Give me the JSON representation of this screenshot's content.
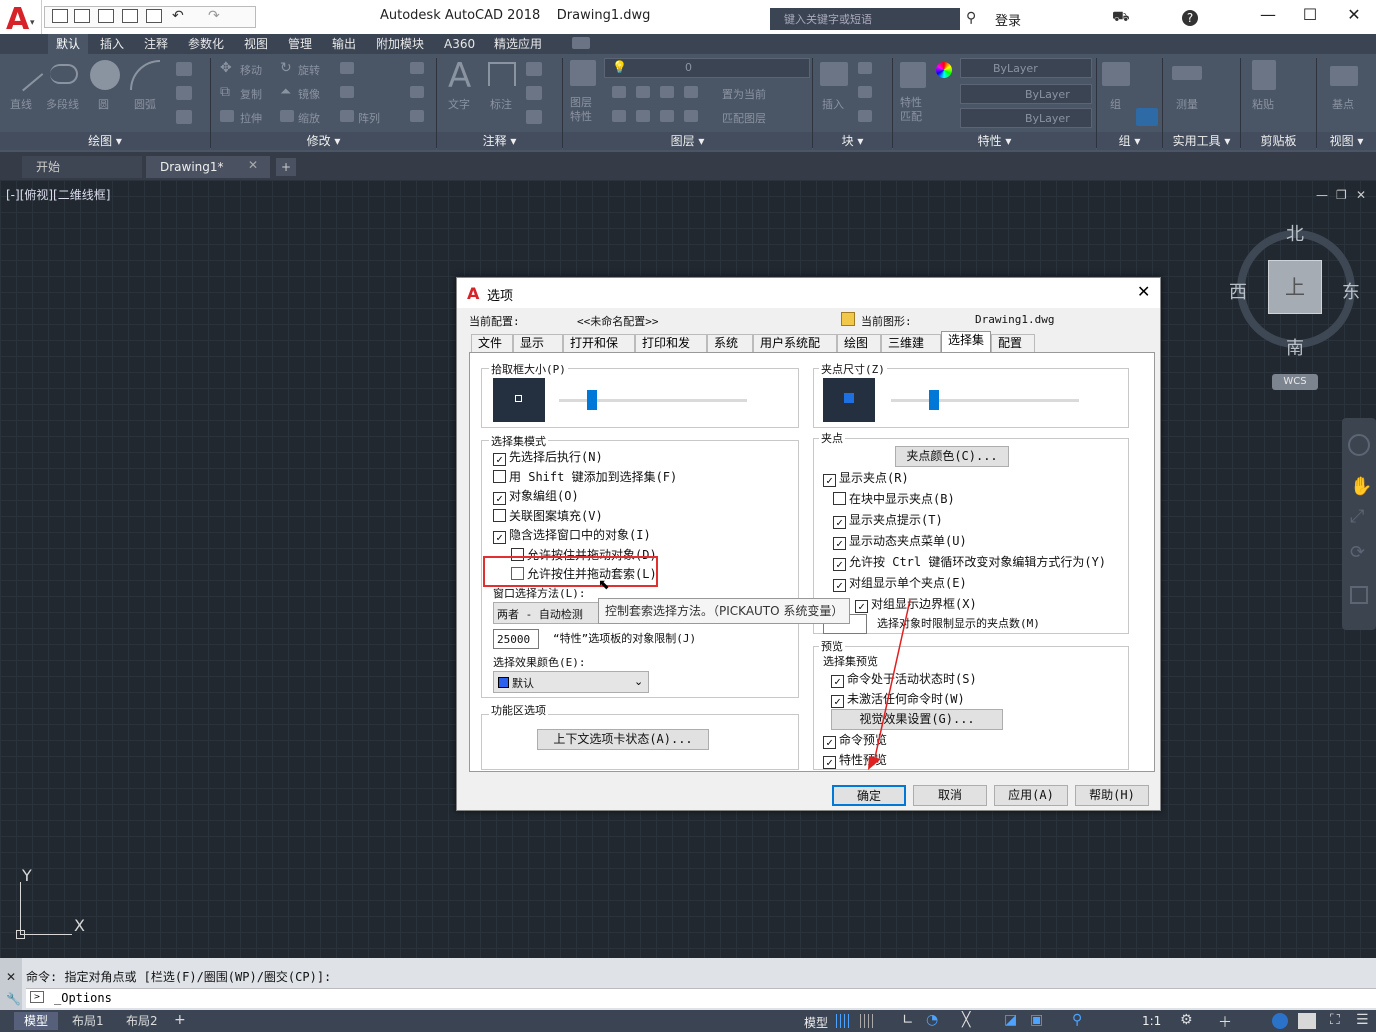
{
  "titlebar": {
    "title": "Autodesk AutoCAD 2018    Drawing1.dwg",
    "search_placeholder": "键入关键字或短语",
    "login": "登录"
  },
  "ribbon_tabs": [
    "默认",
    "插入",
    "注释",
    "参数化",
    "视图",
    "管理",
    "输出",
    "附加模块",
    "A360",
    "精选应用"
  ],
  "ribbon": {
    "draw_tools": [
      "直线",
      "多段线",
      "圆",
      "圆弧"
    ],
    "modify_tools": [
      "移动",
      "旋转",
      "复制",
      "镜像",
      "拉伸",
      "缩放",
      "阵列"
    ],
    "annotation_tools": [
      "文字",
      "标注"
    ],
    "layer_tools": [
      "图层特性",
      "置为当前",
      "匹配图层"
    ],
    "layer_value": "0",
    "block_tools": [
      "插入"
    ],
    "props": [
      "ByLayer",
      "ByLayer",
      "ByLayer"
    ],
    "other_tools": [
      "组",
      "测量",
      "粘贴",
      "基点"
    ],
    "props_match": "特性匹配",
    "panels": [
      "绘图 ▾",
      "修改 ▾",
      "注释 ▾",
      "图层 ▾",
      "块 ▾",
      "特性 ▾",
      "组 ▾",
      "实用工具 ▾",
      "剪贴板",
      "视图 ▾"
    ]
  },
  "doc_tabs": [
    "开始",
    "Drawing1*"
  ],
  "viewport_label": "[-][俯视][二维线框]",
  "viewcube": {
    "north": "北",
    "south": "南",
    "east": "东",
    "west": "西",
    "top": "上",
    "wcs": "WCS"
  },
  "ucs": {
    "y": "Y",
    "x": "X"
  },
  "command": {
    "history": "命令: 指定对角点或 [栏选(F)/圈围(WP)/圈交(CP)]:",
    "input": "_Options"
  },
  "status_tabs": [
    "模型",
    "布局1",
    "布局2"
  ],
  "status_right": {
    "model": "模型",
    "scale": "1:1"
  },
  "dialog": {
    "title": "选项",
    "current_profile_label": "当前配置:",
    "current_profile": "<<未命名配置>>",
    "current_drawing_label": "当前图形:",
    "current_drawing": "Drawing1.dwg",
    "tabs": [
      "文件",
      "显示",
      "打开和保存",
      "打印和发布",
      "系统",
      "用户系统配置",
      "绘图",
      "三维建模",
      "选择集",
      "配置"
    ],
    "pickbox_label": "拾取框大小(P)",
    "grip_size_label": "夹点尺寸(Z)",
    "selection_modes_label": "选择集模式",
    "selection_modes": [
      {
        "label": "先选择后执行(N)",
        "checked": true
      },
      {
        "label": "用 Shift 键添加到选择集(F)",
        "checked": false
      },
      {
        "label": "对象编组(O)",
        "checked": true
      },
      {
        "label": "关联图案填充(V)",
        "checked": false
      },
      {
        "label": "隐含选择窗口中的对象(I)",
        "checked": true
      },
      {
        "label": "允许按住并拖动对象(D)",
        "checked": false
      },
      {
        "label": "允许按住并拖动套索(L)",
        "checked": false
      }
    ],
    "window_method_label": "窗口选择方法(L):",
    "window_method_value": "两者 - 自动检测",
    "limit_value": "25000",
    "limit_label": "“特性”选项板的对象限制(J)",
    "effect_color_label": "选择效果颜色(E):",
    "effect_color_value": "默认",
    "ribbon_options_label": "功能区选项",
    "contextual_button": "上下文选项卡状态(A)...",
    "grips_label": "夹点",
    "grip_color_button": "夹点颜色(C)...",
    "grips": [
      {
        "label": "显示夹点(R)",
        "checked": true
      },
      {
        "label": "在块中显示夹点(B)",
        "checked": false
      },
      {
        "label": "显示夹点提示(T)",
        "checked": true
      },
      {
        "label": "显示动态夹点菜单(U)",
        "checked": true
      },
      {
        "label": "允许按 Ctrl 键循环改变对象编辑方式行为(Y)",
        "checked": true
      },
      {
        "label": "对组显示单个夹点(E)",
        "checked": true
      },
      {
        "label": "对组显示边界框(X)",
        "checked": true
      }
    ],
    "grip_limit_label": "选择对象时限制显示的夹点数(M)",
    "preview_label": "预览",
    "selection_preview_label": "选择集预览",
    "preview_options": [
      {
        "label": "命令处于活动状态时(S)",
        "checked": true
      },
      {
        "label": "未激活任何命令时(W)",
        "checked": true
      }
    ],
    "visual_effects_button": "视觉效果设置(G)...",
    "command_preview": {
      "label": "命令预览",
      "checked": true
    },
    "property_preview": {
      "label": "特性预览",
      "checked": true
    },
    "tooltip": "控制套索选择方法。（PICKAUTO 系统变量）",
    "buttons": {
      "ok": "确定",
      "cancel": "取消",
      "apply": "应用(A)",
      "help": "帮助(H)"
    }
  }
}
